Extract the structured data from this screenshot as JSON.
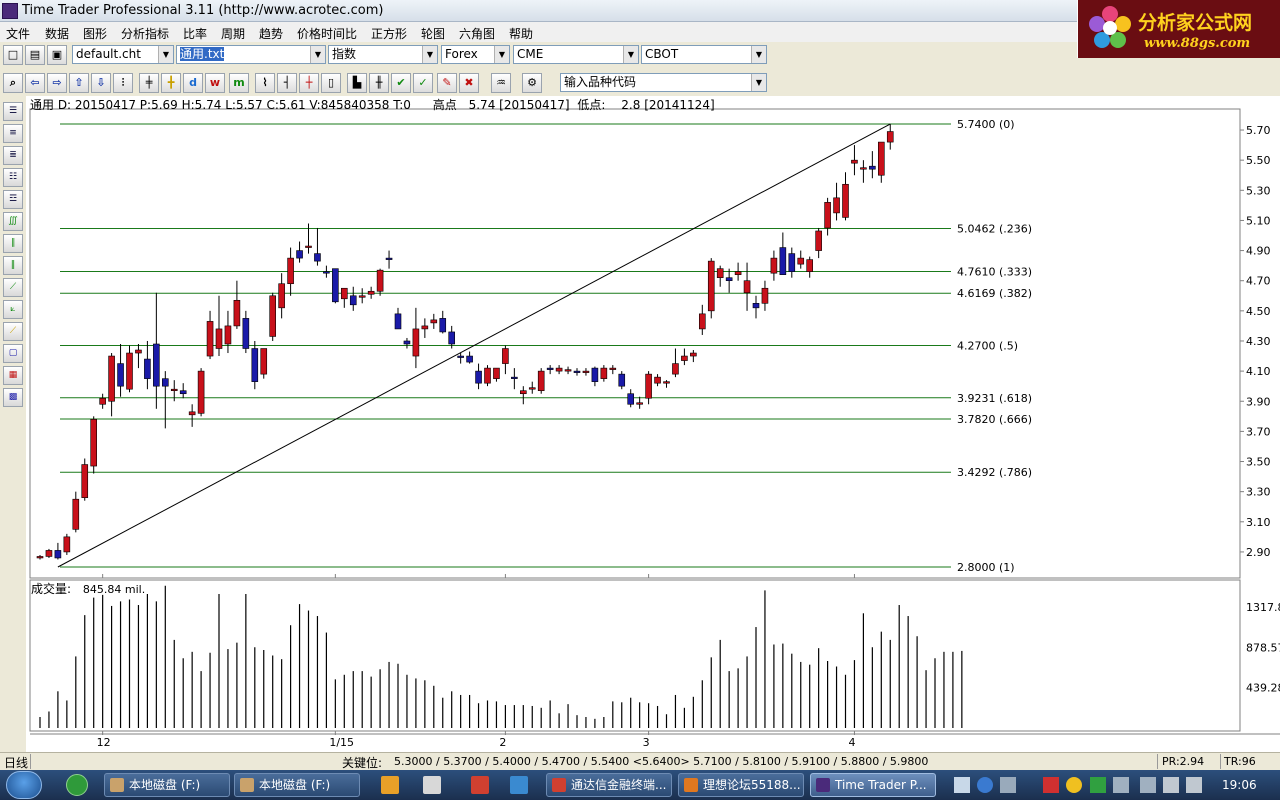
{
  "window": {
    "title": "Time Trader Professional 3.11 (http://www.acrotec.com)"
  },
  "logo": {
    "line1": "分析家公式网",
    "line2": "www.88gs.com"
  },
  "menu": [
    "文件",
    "数据",
    "图形",
    "分析指标",
    "比率",
    "周期",
    "趋势",
    "价格时间比",
    "正方形",
    "轮图",
    "六角图",
    "帮助"
  ],
  "toolbar1": {
    "chart_file": "default.cht",
    "indicator_file": "通用.txt",
    "index_type": "指数",
    "market": "Forex",
    "exchange1": "CME",
    "exchange2": "CBOT"
  },
  "toolbar2": {
    "symbol_input_placeholder": "输入品种代码",
    "button_labels": [
      "d",
      "w",
      "m"
    ]
  },
  "infobar": {
    "text": "通用  D: 20150417  P:5.69  H:5.74  L:5.57  C:5.61  V:845840358  T:0",
    "high_label": "高点",
    "high_value": "5.74 [20150417]",
    "low_label": "低点:",
    "low_value": "2.8 [20141124]"
  },
  "chart_data": {
    "type": "candlestick",
    "price_axis_ticks": [
      "5.70",
      "5.50",
      "5.30",
      "5.10",
      "4.90",
      "4.70",
      "4.50",
      "4.30",
      "4.10",
      "3.90",
      "3.70",
      "3.50",
      "3.30",
      "3.10",
      "2.90"
    ],
    "price_range": [
      2.8,
      5.74
    ],
    "x_tick_labels": [
      "12",
      "1/15",
      "2",
      "3",
      "4"
    ],
    "fib_levels": [
      {
        "value": "5.7400",
        "ratio": "(0)"
      },
      {
        "value": "5.0462",
        "ratio": "(.236)"
      },
      {
        "value": "4.7610",
        "ratio": "(.333)"
      },
      {
        "value": "4.6169",
        "ratio": "(.382)"
      },
      {
        "value": "4.2700",
        "ratio": "(.5)"
      },
      {
        "value": "3.9231",
        "ratio": "(.618)"
      },
      {
        "value": "3.7820",
        "ratio": "(.666)"
      },
      {
        "value": "3.4292",
        "ratio": "(.786)"
      },
      {
        "value": "2.8000",
        "ratio": "(1)"
      }
    ],
    "trendline": {
      "from": [
        2.8,
        "20141124"
      ],
      "to": [
        5.74,
        "20150417"
      ]
    },
    "candles": [
      [
        2.86,
        2.88,
        2.85,
        2.87
      ],
      [
        2.87,
        2.92,
        2.86,
        2.91
      ],
      [
        2.91,
        2.96,
        2.85,
        2.86
      ],
      [
        2.9,
        3.02,
        2.88,
        3.0
      ],
      [
        3.05,
        3.3,
        3.03,
        3.25
      ],
      [
        3.26,
        3.52,
        3.24,
        3.48
      ],
      [
        3.47,
        3.8,
        3.42,
        3.78
      ],
      [
        3.88,
        3.95,
        3.85,
        3.92
      ],
      [
        3.9,
        4.22,
        3.8,
        4.2
      ],
      [
        4.15,
        4.28,
        3.93,
        4.0
      ],
      [
        3.98,
        4.27,
        3.96,
        4.22
      ],
      [
        4.22,
        4.28,
        4.12,
        4.24
      ],
      [
        4.18,
        4.3,
        3.98,
        4.05
      ],
      [
        4.28,
        4.62,
        3.85,
        4.0
      ],
      [
        4.05,
        4.1,
        3.72,
        4.0
      ],
      [
        3.98,
        4.04,
        3.9,
        3.98
      ],
      [
        3.97,
        4.02,
        3.92,
        3.95
      ],
      [
        3.81,
        3.88,
        3.73,
        3.83
      ],
      [
        3.82,
        4.12,
        3.8,
        4.1
      ],
      [
        4.2,
        4.5,
        4.18,
        4.43
      ],
      [
        4.25,
        4.6,
        4.2,
        4.38
      ],
      [
        4.28,
        4.5,
        4.22,
        4.4
      ],
      [
        4.4,
        4.7,
        4.38,
        4.57
      ],
      [
        4.45,
        4.5,
        4.22,
        4.25
      ],
      [
        4.25,
        4.3,
        3.98,
        4.03
      ],
      [
        4.08,
        4.25,
        4.05,
        4.25
      ],
      [
        4.33,
        4.62,
        4.3,
        4.6
      ],
      [
        4.52,
        4.75,
        4.45,
        4.68
      ],
      [
        4.68,
        4.92,
        4.6,
        4.85
      ],
      [
        4.9,
        4.96,
        4.82,
        4.85
      ],
      [
        4.92,
        5.08,
        4.88,
        4.93
      ],
      [
        4.88,
        5.05,
        4.8,
        4.83
      ],
      [
        4.76,
        4.8,
        4.72,
        4.75
      ],
      [
        4.78,
        4.78,
        4.55,
        4.56
      ],
      [
        4.58,
        4.62,
        4.52,
        4.65
      ],
      [
        4.6,
        4.66,
        4.5,
        4.54
      ],
      [
        4.6,
        4.65,
        4.55,
        4.6
      ],
      [
        4.61,
        4.66,
        4.58,
        4.63
      ],
      [
        4.63,
        4.78,
        4.6,
        4.77
      ],
      [
        4.85,
        4.9,
        4.78,
        4.84
      ],
      [
        4.48,
        4.52,
        4.38,
        4.38
      ],
      [
        4.3,
        4.32,
        4.25,
        4.28
      ],
      [
        4.2,
        4.52,
        4.12,
        4.38
      ],
      [
        4.38,
        4.45,
        4.32,
        4.4
      ],
      [
        4.42,
        4.48,
        4.38,
        4.44
      ],
      [
        4.45,
        4.5,
        4.35,
        4.36
      ],
      [
        4.36,
        4.4,
        4.25,
        4.28
      ],
      [
        4.2,
        4.22,
        4.15,
        4.19
      ],
      [
        4.2,
        4.23,
        4.15,
        4.16
      ],
      [
        4.1,
        4.15,
        3.98,
        4.02
      ],
      [
        4.02,
        4.14,
        4.0,
        4.12
      ],
      [
        4.05,
        4.12,
        4.03,
        4.12
      ],
      [
        4.15,
        4.27,
        4.08,
        4.25
      ],
      [
        4.06,
        4.12,
        3.98,
        4.05
      ],
      [
        3.95,
        4.0,
        3.88,
        3.97
      ],
      [
        3.98,
        4.03,
        3.95,
        3.99
      ],
      [
        3.97,
        4.12,
        3.95,
        4.1
      ],
      [
        4.12,
        4.14,
        4.08,
        4.11
      ],
      [
        4.1,
        4.14,
        4.08,
        4.12
      ],
      [
        4.11,
        4.13,
        4.08,
        4.11
      ],
      [
        4.1,
        4.12,
        4.07,
        4.09
      ],
      [
        4.09,
        4.12,
        4.07,
        4.1
      ],
      [
        4.12,
        4.13,
        4.0,
        4.03
      ],
      [
        4.05,
        4.14,
        4.03,
        4.12
      ],
      [
        4.12,
        4.14,
        4.08,
        4.12
      ],
      [
        4.08,
        4.1,
        3.98,
        4.0
      ],
      [
        3.95,
        3.98,
        3.86,
        3.88
      ],
      [
        3.88,
        3.93,
        3.85,
        3.89
      ],
      [
        3.92,
        4.1,
        3.88,
        4.08
      ],
      [
        4.02,
        4.08,
        4.0,
        4.06
      ],
      [
        4.02,
        4.04,
        3.99,
        4.03
      ],
      [
        4.08,
        4.25,
        4.06,
        4.15
      ],
      [
        4.17,
        4.25,
        4.14,
        4.2
      ],
      [
        4.2,
        4.24,
        4.16,
        4.22
      ],
      [
        4.38,
        4.54,
        4.34,
        4.48
      ],
      [
        4.5,
        4.85,
        4.45,
        4.83
      ],
      [
        4.72,
        4.8,
        4.66,
        4.78
      ],
      [
        4.72,
        4.78,
        4.62,
        4.7
      ],
      [
        4.74,
        4.82,
        4.7,
        4.76
      ],
      [
        4.62,
        4.82,
        4.5,
        4.7
      ],
      [
        4.55,
        4.6,
        4.45,
        4.52
      ],
      [
        4.55,
        4.7,
        4.5,
        4.65
      ],
      [
        4.75,
        4.9,
        4.7,
        4.85
      ],
      [
        4.92,
        5.02,
        4.74,
        4.74
      ],
      [
        4.88,
        4.92,
        4.72,
        4.76
      ],
      [
        4.81,
        4.9,
        4.78,
        4.85
      ],
      [
        4.76,
        4.86,
        4.72,
        4.84
      ],
      [
        4.9,
        5.05,
        4.85,
        5.03
      ],
      [
        5.05,
        5.25,
        5.0,
        5.22
      ],
      [
        5.15,
        5.35,
        5.1,
        5.25
      ],
      [
        5.12,
        5.42,
        5.1,
        5.34
      ],
      [
        5.48,
        5.6,
        5.4,
        5.5
      ],
      [
        5.44,
        5.5,
        5.35,
        5.45
      ],
      [
        5.46,
        5.56,
        5.38,
        5.44
      ],
      [
        5.4,
        5.6,
        5.35,
        5.62
      ],
      [
        5.62,
        5.74,
        5.57,
        5.69
      ]
    ],
    "volume_label": "成交量:",
    "volume_value": "845.84 mil.",
    "volume_axis_ticks": [
      "1317.85",
      "878.57",
      "439.28"
    ],
    "volume_range": [
      0,
      1580
    ],
    "volumes": [
      120,
      180,
      400,
      300,
      780,
      1230,
      1420,
      1450,
      1330,
      1380,
      1400,
      1340,
      1460,
      1380,
      1550,
      960,
      760,
      830,
      620,
      820,
      1460,
      860,
      930,
      1460,
      880,
      850,
      790,
      750,
      1120,
      1350,
      1280,
      1220,
      1040,
      530,
      580,
      620,
      620,
      560,
      640,
      720,
      700,
      580,
      540,
      520,
      460,
      330,
      400,
      360,
      360,
      270,
      300,
      290,
      250,
      250,
      250,
      240,
      220,
      300,
      160,
      260,
      140,
      120,
      100,
      120,
      290,
      280,
      330,
      280,
      270,
      240,
      150,
      360,
      220,
      340,
      520,
      770,
      960,
      620,
      650,
      780,
      1100,
      1500,
      910,
      920,
      810,
      720,
      690,
      870,
      730,
      670,
      580,
      740,
      1250,
      880,
      1050,
      960,
      1340,
      1220,
      1000,
      630,
      760,
      830,
      830,
      840
    ],
    "status_keypoints_label": "关键位:",
    "status_keypoints": "5.3000 / 5.3700 / 5.4000 / 5.4700 / 5.5400 <5.6400> 5.7100 / 5.8100 / 5.9100 / 5.8800 / 5.9800",
    "colors": {
      "up": "#c8101a",
      "down": "#1a1aa8",
      "fib": "#1a7a1a",
      "trend": "#000000"
    }
  },
  "statusbar": {
    "period": "日线",
    "keypoints_label": "关键位:",
    "pr": "PR:2.94",
    "tr": "TR:96"
  },
  "taskbar": {
    "items": [
      {
        "label": "本地磁盘 (F:)",
        "color": "#c9a26b"
      },
      {
        "label": "本地磁盘 (F:)",
        "color": "#c9a26b"
      },
      {
        "label": "通达信金融终端...",
        "color": "#d04030"
      },
      {
        "label": "理想论坛55188...",
        "color": "#e07820"
      },
      {
        "label": "Time Trader P...",
        "color": "#4a2a7a"
      }
    ],
    "clock": "19:06"
  }
}
